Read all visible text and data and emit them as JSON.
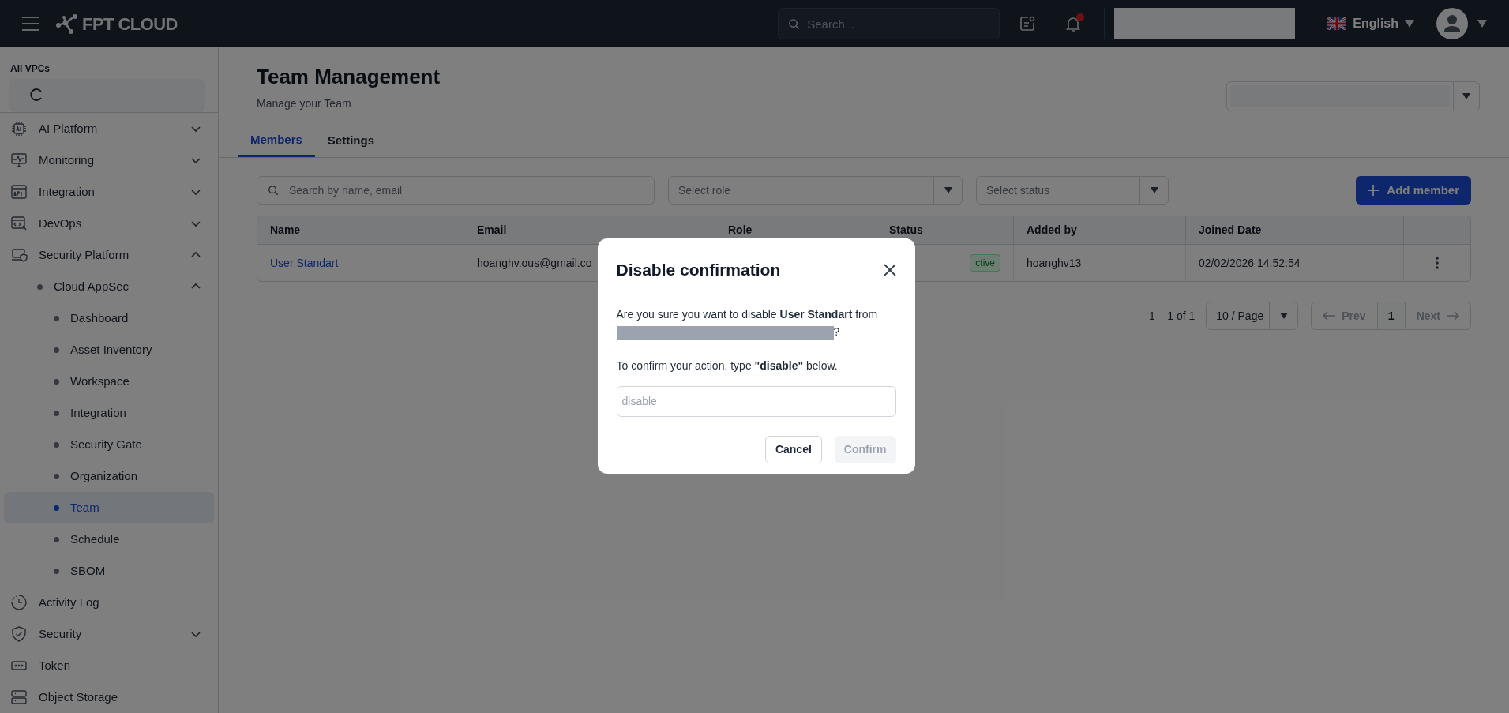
{
  "header": {
    "logo": "FPT CLOUD",
    "search_placeholder": "Search...",
    "has_unread": true,
    "language": "English"
  },
  "sidebar": {
    "vpc_label": "All VPCs",
    "vpc_loading": true,
    "items": [
      {
        "label": "AI Platform",
        "expanded": false,
        "selected": false
      },
      {
        "label": "Monitoring",
        "expanded": false,
        "selected": false
      },
      {
        "label": "Integration",
        "expanded": false,
        "selected": false
      },
      {
        "label": "DevOps",
        "expanded": false,
        "selected": false
      },
      {
        "label": "Security Platform",
        "expanded": true,
        "selected": false,
        "children": [
          {
            "label": "Cloud AppSec",
            "expanded": true,
            "selected": false,
            "children": [
              {
                "label": "Dashboard",
                "selected": false
              },
              {
                "label": "Asset Inventory",
                "selected": false
              },
              {
                "label": "Workspace",
                "selected": false
              },
              {
                "label": "Integration",
                "selected": false
              },
              {
                "label": "Security Gate",
                "selected": false
              },
              {
                "label": "Organization",
                "selected": false
              },
              {
                "label": "Team",
                "selected": true
              },
              {
                "label": "Schedule",
                "selected": false
              },
              {
                "label": "SBOM",
                "selected": false
              }
            ]
          }
        ]
      },
      {
        "label": "Activity Log",
        "selected": false
      },
      {
        "label": "Security",
        "expanded": false,
        "selected": false
      },
      {
        "label": "Token",
        "selected": false
      },
      {
        "label": "Object Storage",
        "selected": false
      }
    ]
  },
  "page": {
    "title": "Team Management",
    "subtitle": "Manage your Team"
  },
  "tabs": [
    {
      "label": "Members",
      "selected": true
    },
    {
      "label": "Settings",
      "selected": false
    }
  ],
  "filters": {
    "search_placeholder": "Search by name, email",
    "role_placeholder": "Select role",
    "status_placeholder": "Select status",
    "add_button": "Add member"
  },
  "table": {
    "columns": [
      "Name",
      "Email",
      "Role",
      "Status",
      "Added by",
      "Joined Date"
    ],
    "rows": [
      {
        "name": "User Standart",
        "email": "hoanghv.ous@gmail.co",
        "status": "ctive",
        "added_by": "hoanghv13",
        "joined": "02/02/2026 14:52:54"
      }
    ]
  },
  "pagination": {
    "range": "1 – 1 of 1",
    "page_size": "10 / Page",
    "prev": "Prev",
    "prev_disabled": true,
    "pages": [
      {
        "label": "1",
        "selected": true
      }
    ],
    "next": "Next",
    "next_disabled": true
  },
  "modal": {
    "title": "Disable confirmation",
    "message": "Are you sure you want to disable **User Standart** from",
    "message_end": "?",
    "instruction": "To confirm your action, type **\"disable\"** below.",
    "input_placeholder": "disable",
    "cancel": "Cancel",
    "confirm": "Confirm",
    "confirm_disabled": true
  }
}
